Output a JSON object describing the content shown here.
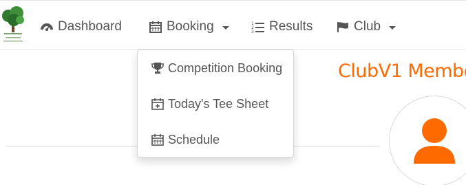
{
  "navbar": {
    "dashboard": {
      "label": "Dashboard",
      "icon": "dashboard-icon"
    },
    "booking": {
      "label": "Booking",
      "icon": "calendar-icon"
    },
    "results": {
      "label": "Results",
      "icon": "list-ordered-icon"
    },
    "club": {
      "label": "Club",
      "icon": "flag-icon"
    }
  },
  "booking_menu": {
    "items": [
      {
        "label": "Competition Booking",
        "icon": "trophy-icon"
      },
      {
        "label": "Today's Tee Sheet",
        "icon": "calendar-plus-icon"
      },
      {
        "label": "Schedule",
        "icon": "calendar-icon"
      }
    ]
  },
  "main": {
    "title": "ClubV1 Membe"
  },
  "colors": {
    "accent": "#ff6a00",
    "text": "#555555",
    "logo_green": "#3f8f3a"
  }
}
